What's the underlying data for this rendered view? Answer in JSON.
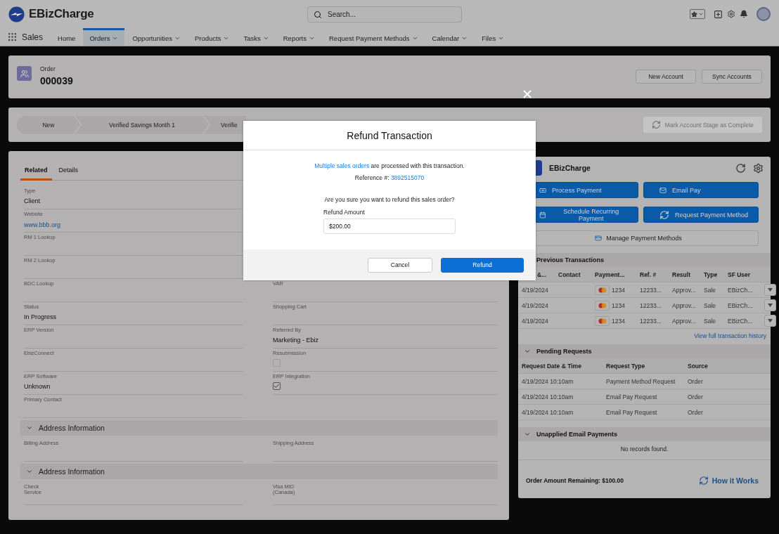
{
  "header": {
    "brand": "EBizCharge",
    "search_placeholder": "Search..."
  },
  "nav": {
    "app": "Sales",
    "items": [
      {
        "label": "Home",
        "dropdown": false,
        "selected": false
      },
      {
        "label": "Orders",
        "dropdown": true,
        "selected": true
      },
      {
        "label": "Opportunities",
        "dropdown": true,
        "selected": false
      },
      {
        "label": "Products",
        "dropdown": true,
        "selected": false
      },
      {
        "label": "Tasks",
        "dropdown": true,
        "selected": false
      },
      {
        "label": "Reports",
        "dropdown": true,
        "selected": false
      },
      {
        "label": "Request Payment Methods",
        "dropdown": true,
        "selected": false
      },
      {
        "label": "Calendar",
        "dropdown": true,
        "selected": false
      },
      {
        "label": "Files",
        "dropdown": true,
        "selected": false
      }
    ]
  },
  "record": {
    "type": "Order",
    "number": "000039",
    "buttons": [
      "New Account",
      "Sync Accounts"
    ]
  },
  "path": {
    "stages": [
      {
        "label": "New"
      },
      {
        "label": "Verified Savings Month 1"
      },
      {
        "label": "Verifie"
      }
    ],
    "action": {
      "label": "Mark Account Stage as Complete",
      "disabled": true
    }
  },
  "tabs": [
    {
      "label": "Related",
      "selected": true
    },
    {
      "label": "Details",
      "selected": false
    }
  ],
  "fields_left": [
    {
      "label": "Type",
      "value": "Client",
      "kind": "text"
    },
    {
      "label": "Website",
      "value": "www.bbb.org",
      "kind": "link"
    },
    {
      "label": "RM 1 Lookup",
      "kind": "text"
    },
    {
      "label": "RM 2 Lookup",
      "kind": "text"
    },
    {
      "label": "BDC Lookup",
      "kind": "text"
    },
    {
      "label": "Status",
      "value": "In Progress",
      "kind": "text"
    },
    {
      "label": "ERP Version",
      "kind": "text"
    },
    {
      "label": "EbizConnect",
      "kind": "text"
    },
    {
      "label": "ERP Software",
      "value": "Unknown",
      "kind": "text"
    },
    {
      "label": "Primary Contact",
      "kind": "text"
    }
  ],
  "fields_right": [
    {
      "label": "VAR",
      "kind": "text"
    },
    {
      "label": "Shopping Cart",
      "kind": "text"
    },
    {
      "label": "Referred By",
      "value": "Marketing - Ebiz",
      "kind": "text"
    },
    {
      "label": "Resubmission",
      "kind": "checkbox",
      "checked": false
    },
    {
      "label": "ERP Integration",
      "kind": "checkbox",
      "checked": true
    }
  ],
  "sections": [
    {
      "title": "Address Information",
      "expanded": true,
      "fields": [
        "Billing Address",
        "Shipping Address"
      ]
    },
    {
      "title": "Address Information",
      "expanded": true,
      "fields": [
        "Check\nService",
        "Visa MID\n(Canada)"
      ]
    }
  ],
  "ebiz": {
    "title": "EBizCharge",
    "actions": [
      {
        "label": "Process Payment"
      },
      {
        "label": "Email Pay"
      },
      {
        "label": "Schedule Recurring Payment"
      },
      {
        "label": "Request Payment Method"
      }
    ],
    "manage": "Manage Payment Methods",
    "previous": {
      "title": "Previous Transactions",
      "columns": [
        "&...",
        "Contact",
        "Payment...",
        "Ref. #",
        "Result",
        "Type",
        "SF User"
      ],
      "rows": [
        {
          "date": "4/19/2024",
          "last4": "1234",
          "ref": "12233...",
          "result": "Approv...",
          "type": "Sale",
          "user": "EBizCh..."
        },
        {
          "date": "4/19/2024",
          "last4": "1234",
          "ref": "12233...",
          "result": "Approv...",
          "type": "Sale",
          "user": "EBizCh..."
        },
        {
          "date": "4/19/2024",
          "last4": "1234",
          "ref": "12233...",
          "result": "Approv...",
          "type": "Sale",
          "user": "EBizCh..."
        }
      ],
      "link": "View full transaction history"
    },
    "pending": {
      "title": "Pending Requests",
      "expanded": true,
      "columns": [
        "Request Date & Time",
        "Request Type",
        "Source"
      ],
      "rows": [
        [
          "4/19/2024 10:10am",
          "Payment Method Request",
          "Order"
        ],
        [
          "4/19/2024 10:10am",
          "Email Pay Request",
          "Order"
        ],
        [
          "4/19/2024 10:10am",
          "Email Pay Request",
          "Order"
        ]
      ]
    },
    "unapplied": {
      "title": "Unapplied Email Payments",
      "expanded": true,
      "empty": "No records found."
    },
    "remaining": "Order Amount Remaining: $100.00",
    "help": "How it Works"
  },
  "modal": {
    "title": "Refund Transaction",
    "notice_link": "Multiple sales orders",
    "notice_rest": " are processed with this transaction.",
    "reference_label": "Reference #: ",
    "reference": "3892515070",
    "question": "Are you sure you want to refund this sales order?",
    "amount_label": "Refund Amount",
    "amount_value": "$200.00",
    "buttons": [
      {
        "label": "Cancel",
        "kind": "secondary"
      },
      {
        "label": "Refund",
        "kind": "primary"
      }
    ]
  }
}
